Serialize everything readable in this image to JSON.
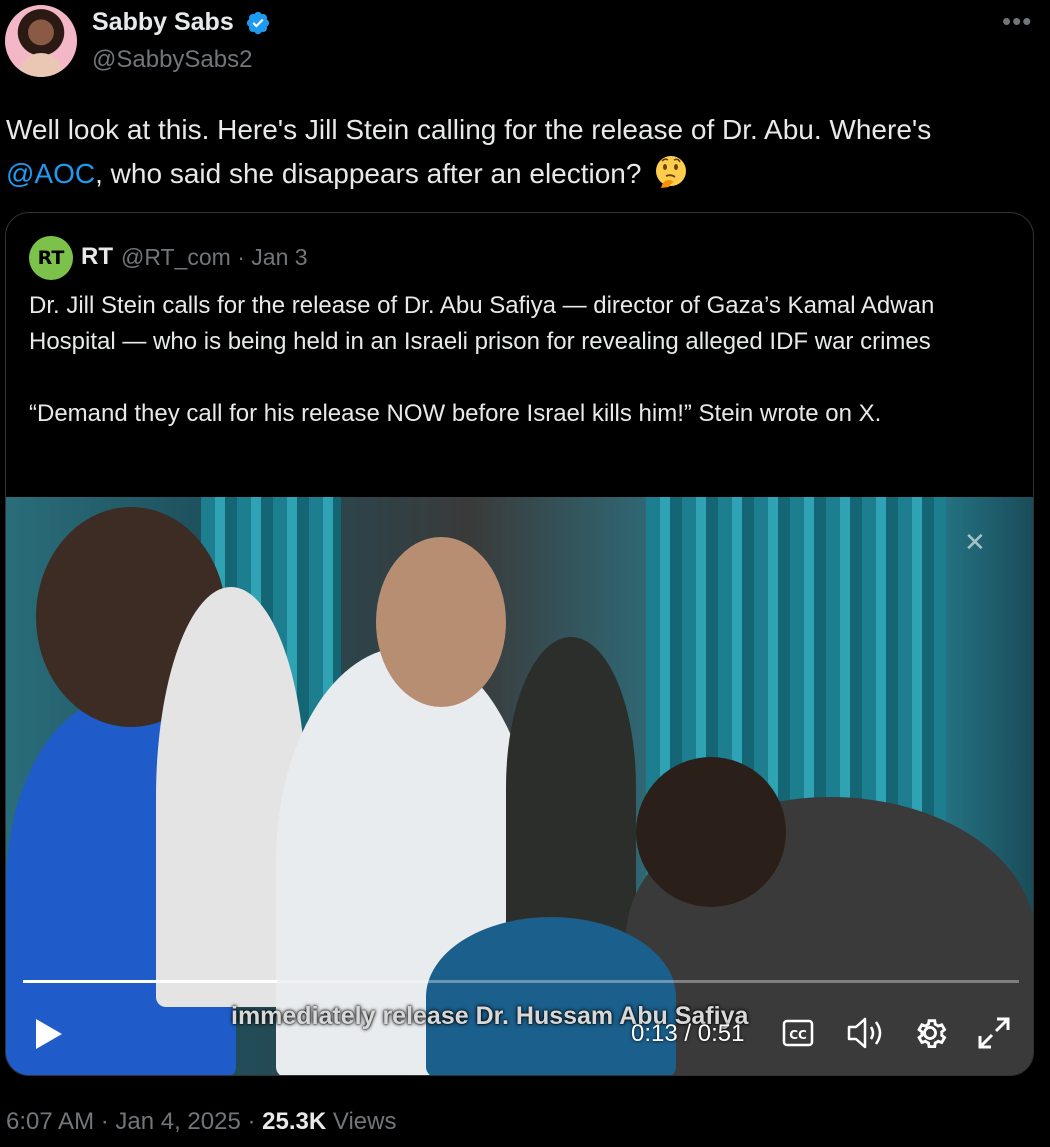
{
  "author": {
    "name": "Sabby Sabs",
    "handle": "@SabbySabs2",
    "verified": true
  },
  "tweet": {
    "text_before": "Well look at this. Here's Jill Stein calling for the release of Dr. Abu. Where's",
    "mention": "@AOC",
    "text_after": ", who said she disappears after an election?",
    "emoji": "thinking-face-icon"
  },
  "quoted": {
    "logo_text": "RT",
    "name": "RT",
    "meta": "@RT_com · Jan 3",
    "paragraph1": "Dr. Jill Stein calls for the release of Dr. Abu Safiya — director of Gaza’s Kamal Adwan Hospital — who is being held in an Israeli prison for revealing alleged IDF war crimes",
    "paragraph2": "“Demand they call for his release NOW before Israel kills him!” Stein wrote on X."
  },
  "video": {
    "subtitle": "immediately release Dr. Hussam Abu Safiya",
    "time": "0:13 / 0:51",
    "progress": 0.255,
    "controls": [
      "play-icon",
      "cc-icon",
      "volume-icon",
      "settings-gear-icon",
      "fullscreen-icon"
    ]
  },
  "footer": {
    "time": "6:07 AM · Jan 4, 2025 · ",
    "views_count": "25.3K",
    "views_label": " Views"
  },
  "colors": {
    "background": "#000000",
    "text": "#e7e9ea",
    "muted": "#71767b",
    "accent": "#1d9bf0",
    "rt_green": "#7cc24a"
  }
}
